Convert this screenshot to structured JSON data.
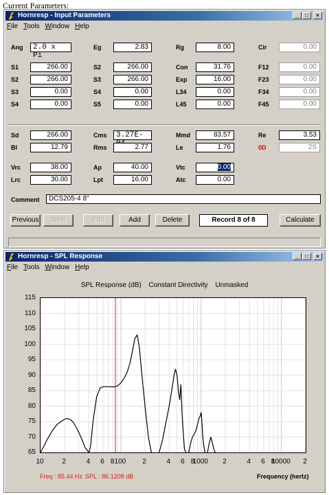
{
  "caption": "Current Parameters:",
  "input_window": {
    "title": "Hornresp - Input Parameters",
    "menu": [
      "File",
      "Tools",
      "Window",
      "Help"
    ],
    "rows": [
      [
        {
          "l": "Ang",
          "v": "2.0 x Pi",
          "mono": true
        },
        {
          "l": "Eg",
          "v": "2.83"
        },
        {
          "l": "Rg",
          "v": "8.00"
        },
        {
          "l": "Cir",
          "v": "0.00",
          "dis": true
        }
      ],
      [
        {
          "l": "S1",
          "v": "266.00"
        },
        {
          "l": "S2",
          "v": "266.00"
        },
        {
          "l": "Con",
          "v": "31.76"
        },
        {
          "l": "F12",
          "v": "0.00",
          "dis": true
        }
      ],
      [
        {
          "l": "S2",
          "v": "266.00"
        },
        {
          "l": "S3",
          "v": "266.00"
        },
        {
          "l": "Exp",
          "v": "16.00"
        },
        {
          "l": "F23",
          "v": "0.00",
          "dis": true
        }
      ],
      [
        {
          "l": "S3",
          "v": "0.00"
        },
        {
          "l": "S4",
          "v": "0.00"
        },
        {
          "l": "L34",
          "v": "0.00"
        },
        {
          "l": "F34",
          "v": "0.00",
          "dis": true
        }
      ],
      [
        {
          "l": "S4",
          "v": "0.00"
        },
        {
          "l": "S5",
          "v": "0.00"
        },
        {
          "l": "L45",
          "v": "0.00"
        },
        {
          "l": "F45",
          "v": "0.00",
          "dis": true
        }
      ],
      [
        {
          "l": "Sd",
          "v": "266.00"
        },
        {
          "l": "Cms",
          "v": "3.27E-04",
          "mono": true
        },
        {
          "l": "Mmd",
          "v": "83.57"
        },
        {
          "l": "Re",
          "v": "3.53"
        }
      ],
      [
        {
          "l": "Bl",
          "v": "12.79"
        },
        {
          "l": "Rms",
          "v": "2.77"
        },
        {
          "l": "Le",
          "v": "1.76"
        },
        {
          "l": "0D",
          "v": "2S",
          "dis": true,
          "red": true
        }
      ],
      [
        {
          "l": "Vrc",
          "v": "38.00"
        },
        {
          "l": "Ap",
          "v": "40.00"
        },
        {
          "l": "Vtc",
          "v": "0.00",
          "sel": true
        }
      ],
      [
        {
          "l": "Lrc",
          "v": "30.00"
        },
        {
          "l": "Lpt",
          "v": "16.00"
        },
        {
          "l": "Atc",
          "v": "0.00"
        }
      ]
    ],
    "comment_label": "Comment",
    "comment_value": "DCS205-4 8\"",
    "buttons": {
      "previous": "Previous",
      "next": "Next",
      "edit": "Edit",
      "add": "Add",
      "delete": "Delete",
      "calculate": "Calculate"
    },
    "record": "Record 8 of 8"
  },
  "spl_window": {
    "title": "Hornresp - SPL Response",
    "menu": [
      "File",
      "Tools",
      "Window",
      "Help"
    ],
    "heading": [
      "SPL Response (dB)",
      "Constant Directivity",
      "Unmasked"
    ],
    "readout_freq": "Freq : 85.44 Hz",
    "readout_spl": "SPL : 86.1208 dB",
    "x_title": "Frequency (hertz)"
  },
  "chart_data": {
    "type": "line",
    "title": "SPL Response (dB)",
    "xlabel": "Frequency (hertz)",
    "ylabel": "",
    "x_scale": "log",
    "xlim": [
      10,
      20000
    ],
    "ylim": [
      65,
      115
    ],
    "y_ticks": [
      "115",
      "110",
      "105",
      "100",
      "95",
      "90",
      "85",
      "80",
      "75",
      "70",
      "65"
    ],
    "x_tick_labels": [
      {
        "f": 10,
        "t": "10"
      },
      {
        "f": 20,
        "t": "2"
      },
      {
        "f": 40,
        "t": "4"
      },
      {
        "f": 60,
        "t": "6"
      },
      {
        "f": 80,
        "t": "8"
      },
      {
        "f": 100,
        "t": "100"
      },
      {
        "f": 200,
        "t": "2"
      },
      {
        "f": 400,
        "t": "4"
      },
      {
        "f": 600,
        "t": "6"
      },
      {
        "f": 800,
        "t": "8"
      },
      {
        "f": 1000,
        "t": "1000"
      },
      {
        "f": 2000,
        "t": "2"
      },
      {
        "f": 4000,
        "t": "4"
      },
      {
        "f": 6000,
        "t": "6"
      },
      {
        "f": 8000,
        "t": "8"
      },
      {
        "f": 10000,
        "t": "10000"
      },
      {
        "f": 20000,
        "t": "2"
      }
    ],
    "cursor_freq": 85.44,
    "series": [
      {
        "x": [
          10,
          11,
          12,
          14,
          16,
          18,
          20,
          22,
          24,
          26,
          28,
          30,
          33,
          36,
          40,
          42,
          45,
          50,
          55,
          60,
          70,
          80,
          90,
          100,
          110,
          120,
          130,
          140,
          150,
          160,
          170,
          180,
          200,
          220,
          240
        ],
        "y": [
          65,
          67,
          69,
          72,
          74,
          75,
          75.8,
          76,
          75.5,
          74.5,
          73,
          71.5,
          69,
          66.5,
          65,
          67,
          75,
          83,
          85.8,
          86.3,
          86.3,
          86.2,
          86.5,
          87.5,
          89,
          91,
          94,
          98,
          102,
          103,
          99,
          92,
          80,
          70,
          65
        ]
      },
      {
        "x": [
          300,
          330,
          360,
          400,
          430,
          460,
          480,
          500,
          520,
          540,
          560,
          580,
          600,
          620,
          650
        ],
        "y": [
          65,
          69,
          74,
          80,
          85,
          90,
          92,
          90,
          85,
          82,
          87,
          77,
          71,
          66,
          65
        ]
      },
      {
        "x": [
          700,
          740,
          780,
          820,
          860,
          900,
          940,
          980,
          1000,
          1020,
          1050,
          1080,
          1120
        ],
        "y": [
          65,
          68,
          70,
          71,
          72,
          74,
          76,
          77,
          78,
          75,
          70,
          67,
          65
        ]
      },
      {
        "x": [
          1200,
          1260,
          1320,
          1380,
          1440,
          1500
        ],
        "y": [
          65,
          68,
          70,
          68,
          66,
          65
        ]
      }
    ]
  }
}
